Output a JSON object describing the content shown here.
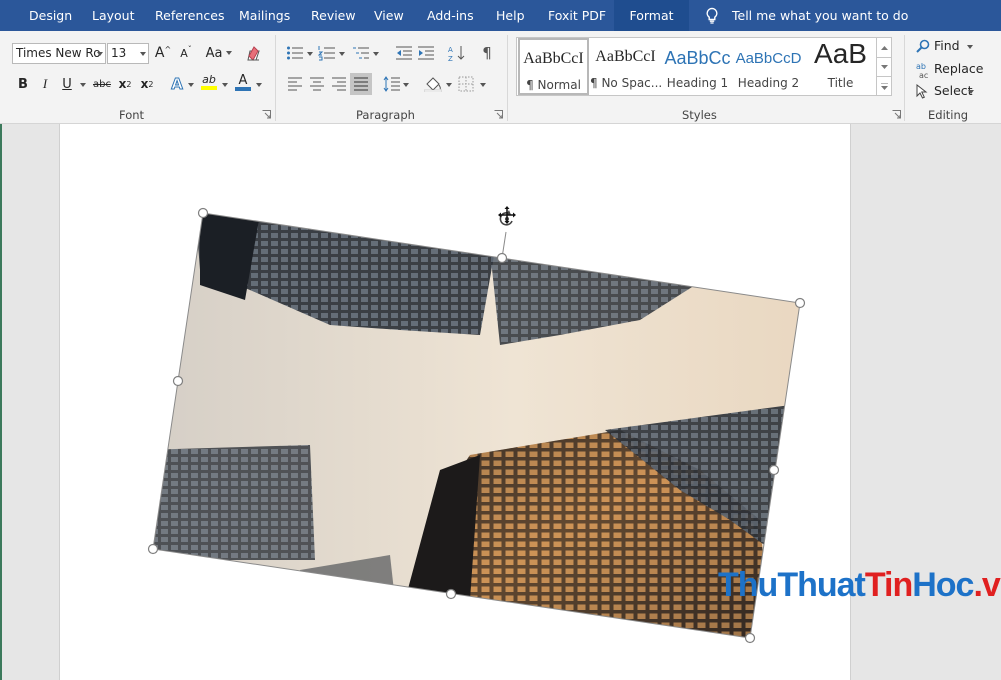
{
  "tabs": [
    {
      "label": "Design",
      "active": false
    },
    {
      "label": "Layout",
      "active": false
    },
    {
      "label": "References",
      "active": false
    },
    {
      "label": "Mailings",
      "active": false
    },
    {
      "label": "Review",
      "active": false
    },
    {
      "label": "View",
      "active": false
    },
    {
      "label": "Add-ins",
      "active": false
    },
    {
      "label": "Help",
      "active": false
    },
    {
      "label": "Foxit PDF",
      "active": false
    },
    {
      "label": "Format",
      "active": true
    }
  ],
  "tell_me": "Tell me what you want to do",
  "font_group": {
    "label": "Font",
    "font_name": "Times New Ro",
    "font_size": "13",
    "bold": "B",
    "italic": "I",
    "underline": "U",
    "strikethrough": "abc",
    "subscript": "x",
    "subscript_mark": "2",
    "superscript": "x",
    "superscript_mark": "2",
    "grow_font": "A",
    "shrink_font": "A",
    "change_case": "Aa",
    "highlight": "ab",
    "font_color": "A",
    "text_effects": "A"
  },
  "paragraph_group": {
    "label": "Paragraph"
  },
  "styles_group": {
    "label": "Styles",
    "items": [
      {
        "sample": "AaBbCcI",
        "label": "¶ Normal",
        "selected": true
      },
      {
        "sample": "AaBbCcI",
        "label": "¶ No Spac...",
        "selected": false
      },
      {
        "sample": "AaBbCc",
        "label": "Heading 1",
        "selected": false
      },
      {
        "sample": "AaBbCcD",
        "label": "Heading 2",
        "selected": false
      },
      {
        "sample": "AaB",
        "label": "Title",
        "selected": false
      }
    ]
  },
  "editing_group": {
    "label": "Editing",
    "find": "Find",
    "replace": "Replace",
    "select": "Select"
  },
  "watermark": {
    "part1": "Thu",
    "part2": "Thuat",
    "part3": "Tin",
    "part4": "Hoc",
    "part5": ".vn"
  },
  "colors": {
    "ribbon_blue": "#2b579a",
    "heading_blue": "#2e74b5",
    "highlight_yellow": "#ffff00",
    "font_color_blue": "#2e74b5",
    "watermark_blue": "#1d72c8",
    "watermark_red": "#e02020"
  }
}
